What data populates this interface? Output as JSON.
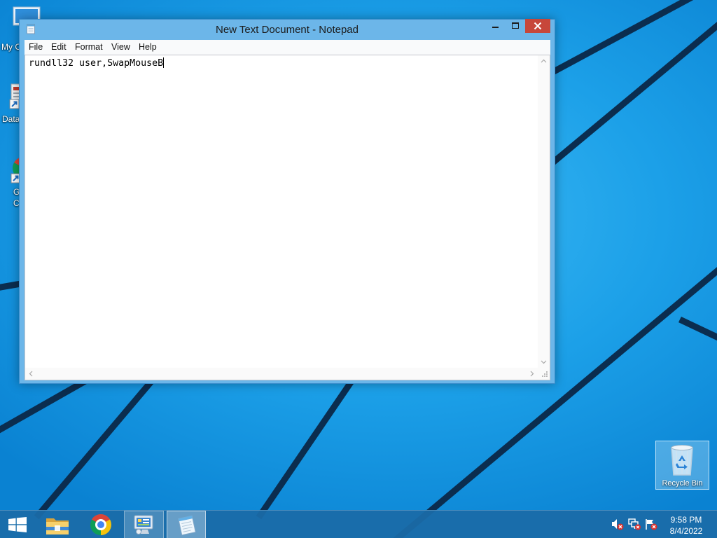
{
  "window": {
    "title": "New Text Document - Notepad",
    "icon": "notepad-icon",
    "controls": [
      "minimize-icon",
      "maximize-icon",
      "close-icon"
    ]
  },
  "menu": {
    "file": "File",
    "edit": "Edit",
    "format": "Format",
    "view": "View",
    "help": "Help"
  },
  "editor": {
    "text": "rundll32 user,SwapMouseB"
  },
  "desktop": {
    "icons": [
      {
        "icon": "computer-icon",
        "label": "My C"
      },
      {
        "icon": "data-shortcut-icon",
        "label": "Data"
      },
      {
        "icon": "chrome-shortcut-icon",
        "label_lines": [
          "G",
          "C"
        ]
      }
    ],
    "recycle_bin": {
      "icon": "recycle-bin-icon",
      "label": "Recycle Bin",
      "selected": true
    }
  },
  "taskbar": {
    "items": [
      {
        "icon": "windows-logo-icon"
      },
      {
        "icon": "file-explorer-icon"
      },
      {
        "icon": "chrome-icon"
      },
      {
        "icon": "control-panel-icon",
        "running": true
      },
      {
        "icon": "notepad-icon",
        "active": true
      }
    ],
    "tray": [
      {
        "icon": "volume-muted-icon"
      },
      {
        "icon": "network-error-icon"
      },
      {
        "icon": "action-center-alert-icon"
      }
    ],
    "clock": {
      "time": "9:58 PM",
      "date": "8/4/2022"
    }
  },
  "colors": {
    "desktop_blue": "#1ca0e8",
    "wallpaper_stripe": "#0b2d4f",
    "window_frame": "#6cb6e9",
    "close_button": "#c7473a",
    "taskbar": "#1b6ba8"
  }
}
